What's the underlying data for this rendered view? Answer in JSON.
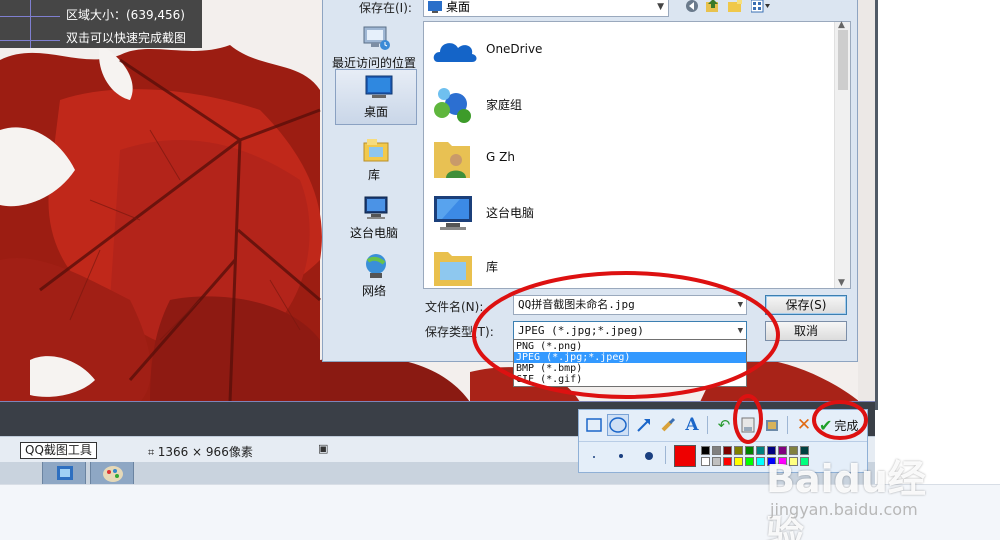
{
  "info_overlay": {
    "region_size": "区域大小：(639,456)",
    "hint": "双击可以快速完成截图"
  },
  "dialog": {
    "save_in_label": "保存在(I):",
    "save_in_value": "桌面",
    "places": [
      {
        "label": "最近访问的位置",
        "icon": "recent-places-icon"
      },
      {
        "label": "桌面",
        "icon": "desktop-icon",
        "selected": true
      },
      {
        "label": "库",
        "icon": "libraries-icon"
      },
      {
        "label": "这台电脑",
        "icon": "computer-icon"
      },
      {
        "label": "网络",
        "icon": "network-icon"
      }
    ],
    "files": [
      {
        "label": "OneDrive",
        "icon": "onedrive-icon"
      },
      {
        "label": "家庭组",
        "icon": "homegroup-icon"
      },
      {
        "label": "G Zh",
        "icon": "user-folder-icon"
      },
      {
        "label": "这台电脑",
        "icon": "computer-icon"
      },
      {
        "label": "库",
        "icon": "libraries-folder-icon"
      }
    ],
    "filename_label": "文件名(N):",
    "filename_value": "QQ拼音截图未命名.jpg",
    "filetype_label": "保存类型(T):",
    "filetype_value": "JPEG (*.jpg;*.jpeg)",
    "filetype_options": [
      "PNG (*.png)",
      "JPEG (*.jpg;*.jpeg)",
      "BMP (*.bmp)",
      "GIF (*.gif)"
    ],
    "filetype_selected_index": 1,
    "save_button": "保存(S)",
    "cancel_button": "取消"
  },
  "toolbar": {
    "done_label": "完成",
    "tools": [
      "rectangle-icon",
      "ellipse-icon",
      "arrow-icon",
      "brush-icon",
      "text-icon",
      "undo-icon",
      "save-icon",
      "copy-icon",
      "cancel-icon",
      "done-icon"
    ],
    "current_color": "#ee0000",
    "palette": [
      "#000000",
      "#808080",
      "#800000",
      "#808000",
      "#008000",
      "#008080",
      "#000080",
      "#800080",
      "#808040",
      "#004040",
      "#ffffff",
      "#c0c0c0",
      "#ff0000",
      "#ffff00",
      "#00ff00",
      "#00ffff",
      "#0000ff",
      "#ff00ff",
      "#ffff80",
      "#00ff80"
    ]
  },
  "statusbar": {
    "tool_label": "QQ截图工具",
    "image_size": "1366 × 966像素"
  },
  "watermark": {
    "logo_text": "Baidu经验",
    "url": "jingyan.baidu.com"
  }
}
